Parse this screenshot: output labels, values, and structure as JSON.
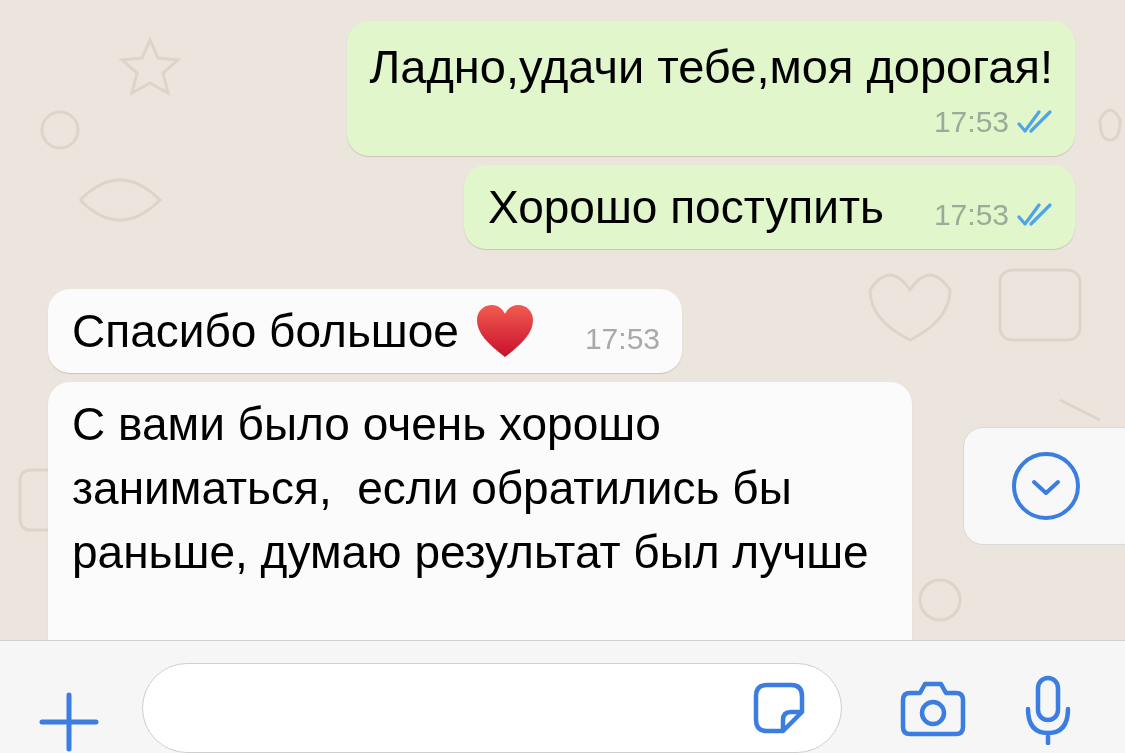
{
  "messages": [
    {
      "kind": "outgoing",
      "text": "Ладно,удачи тебе,моя дорогая!",
      "time": "17:53",
      "read": true
    },
    {
      "kind": "outgoing",
      "text": "Хорошо поступить",
      "time": "17:53",
      "read": true
    },
    {
      "kind": "incoming",
      "text": "Спасибо большое",
      "time": "17:53",
      "heart": true
    },
    {
      "kind": "incoming",
      "text": "С вами было очень хорошо заниматься,  если обратились бы раньше, думаю результат был лучше"
    }
  ]
}
